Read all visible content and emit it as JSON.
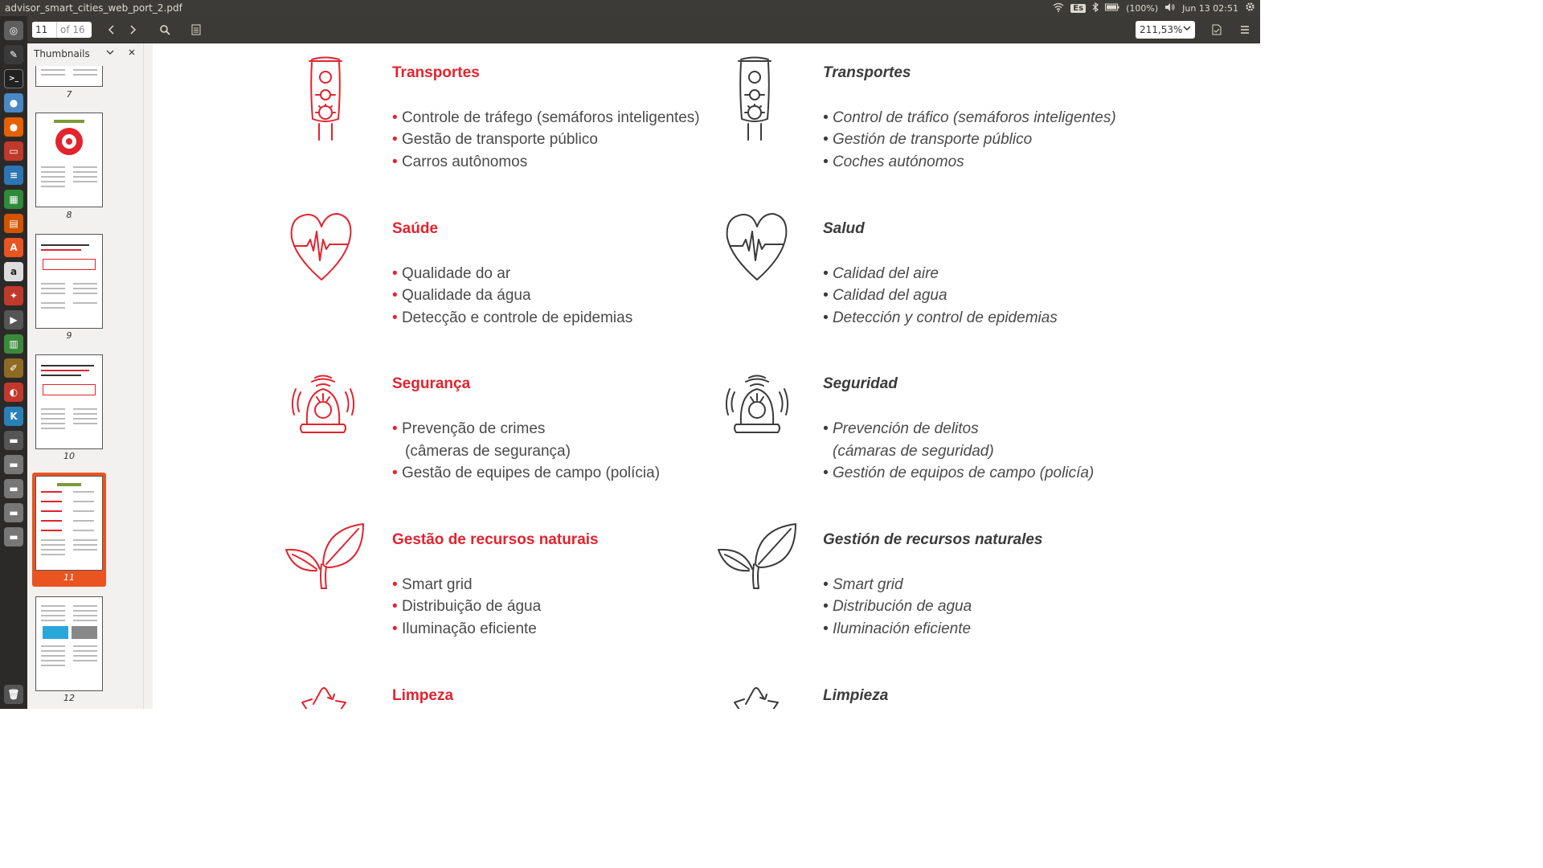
{
  "window": {
    "title": "advisor_smart_cities_web_port_2.pdf",
    "keyboard": "Es",
    "battery": "(100%)",
    "datetime": "Jun 13 02:51"
  },
  "toolbar": {
    "page_value": "11",
    "page_of": "of 16",
    "zoom": "211,53%"
  },
  "sidebar": {
    "title": "Thumbnails",
    "thumbnails": [
      {
        "label": "7"
      },
      {
        "label": "8"
      },
      {
        "label": "9"
      },
      {
        "label": "10"
      },
      {
        "label": "11"
      },
      {
        "label": "12"
      }
    ]
  },
  "document": {
    "pt": [
      {
        "heading": "Transportes",
        "icon": "traffic-light-icon",
        "items": [
          "Controle de tráfego (semáforos inteligentes)",
          "Gestão de transporte público",
          "Carros autônomos"
        ]
      },
      {
        "heading": "Saúde",
        "icon": "heart-pulse-icon",
        "items": [
          "Qualidade do ar",
          "Qualidade da água",
          "Detecção e controle de epidemias"
        ]
      },
      {
        "heading": "Segurança",
        "icon": "siren-icon",
        "items": [
          "Prevenção de crimes",
          "(câmeras de segurança)",
          "Gestão de equipes de campo (polícia)"
        ]
      },
      {
        "heading": "Gestão de recursos naturais",
        "icon": "leaf-icon",
        "items": [
          "Smart grid",
          "Distribuição de água",
          "Iluminação eficiente"
        ]
      },
      {
        "heading": "Limpeza",
        "icon": "recycle-icon",
        "items": []
      }
    ],
    "es": [
      {
        "heading": "Transportes",
        "icon": "traffic-light-icon",
        "items": [
          "Control de tráfico (semáforos inteligentes)",
          "Gestión de transporte público",
          "Coches autónomos"
        ]
      },
      {
        "heading": "Salud",
        "icon": "heart-pulse-icon",
        "items": [
          "Calidad del aire",
          "Calidad del agua",
          "Detección y control de epidemias"
        ]
      },
      {
        "heading": "Seguridad",
        "icon": "siren-icon",
        "items": [
          "Prevención de delitos",
          "(cámaras de seguridad)",
          "Gestión de equipos de campo (policía)"
        ]
      },
      {
        "heading": "Gestión de recursos naturales",
        "icon": "leaf-icon",
        "items": [
          "Smart grid",
          "Distribución de agua",
          "Iluminación eficiente"
        ]
      },
      {
        "heading": "Limpieza",
        "icon": "recycle-icon",
        "items": []
      }
    ],
    "colors": {
      "accent": "#e3232e",
      "dark": "#3b3b3b"
    }
  }
}
